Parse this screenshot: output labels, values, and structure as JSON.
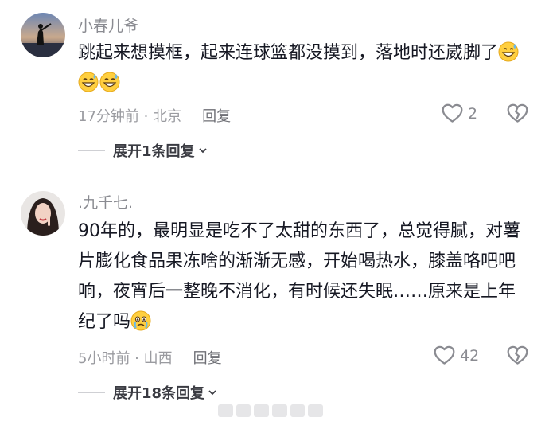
{
  "comments": [
    {
      "username": "小春儿爷",
      "text": "跳起来想摸框，起来连球篮都没摸到，落地时还崴脚了",
      "emoji_name": "grinning-sweat-emoji",
      "emoji_count": 3,
      "time": "17分钟前",
      "location": "北京",
      "reply_label": "回复",
      "likes": "2",
      "expand_label": "展开1条回复"
    },
    {
      "username": ".九千七.",
      "text": "90年的，最明显是吃不了太甜的东西了，总觉得腻，对薯片膨化食品果冻啥的渐渐无感，开始喝热水，膝盖咯吧吧响，夜宵后一整晚不消化，有时候还失眠……原来是上年纪了吗",
      "emoji_name": "crying-emoji",
      "emoji_count": 1,
      "time": "5小时前",
      "location": "山西",
      "reply_label": "回复",
      "likes": "42",
      "expand_label": "展开18条回复"
    }
  ],
  "separator": " · ",
  "colors": {
    "text": "#161823",
    "meta": "#9a9ba0",
    "username": "#8a8b91"
  },
  "icons": [
    "heart-icon",
    "broken-heart-icon",
    "chevron-down-icon"
  ]
}
